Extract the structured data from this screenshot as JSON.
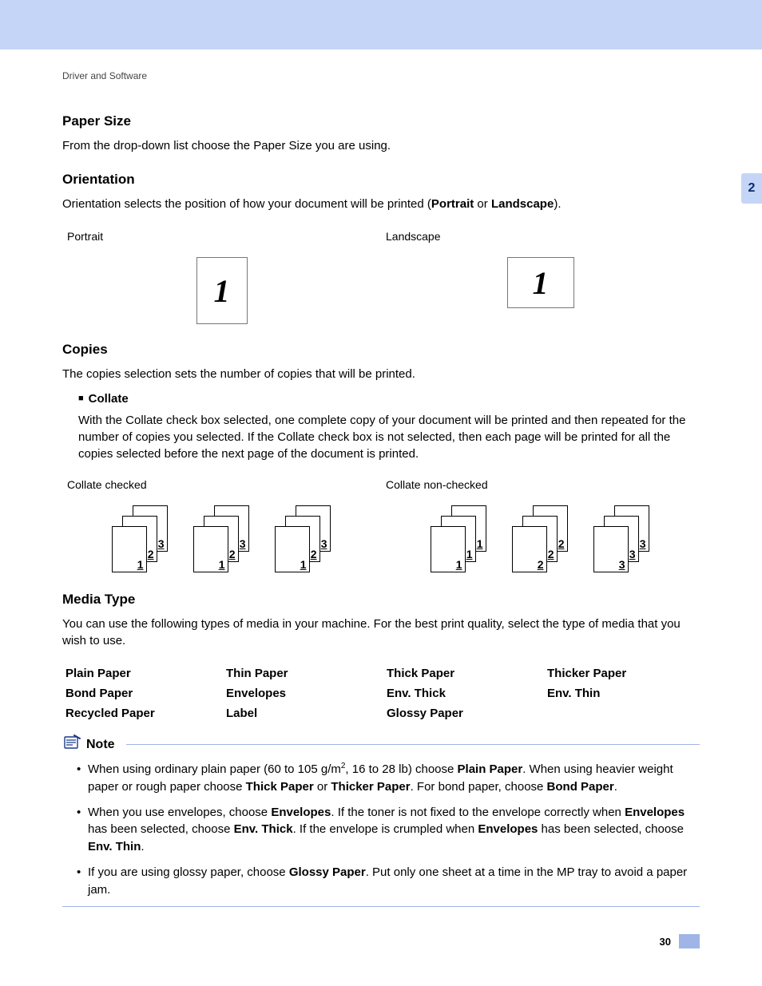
{
  "breadcrumb": "Driver and Software",
  "chapter_tab": "2",
  "paper_size": {
    "heading": "Paper Size",
    "text": "From the drop-down list choose the Paper Size you are using."
  },
  "orientation": {
    "heading": "Orientation",
    "pre": "Orientation selects the position of how your document will be printed (",
    "bold1": "Portrait",
    "mid": " or ",
    "bold2": "Landscape",
    "post": ").",
    "portrait_label": "Portrait",
    "landscape_label": "Landscape",
    "thumb_glyph": "1"
  },
  "copies": {
    "heading": "Copies",
    "text": "The copies selection sets the number of copies that will be printed.",
    "collate_heading": "Collate",
    "collate_text": "With the Collate check box selected, one complete copy of your document will be printed and then repeated for the number of copies you selected. If the Collate check box is not selected, then each page will be printed for all the copies selected before the next page of the document is printed.",
    "checked_label": "Collate checked",
    "nonchecked_label": "Collate non-checked",
    "checked_sets": [
      [
        "1",
        "2",
        "3"
      ],
      [
        "1",
        "2",
        "3"
      ],
      [
        "1",
        "2",
        "3"
      ]
    ],
    "nonchecked_sets": [
      [
        "1",
        "1",
        "1"
      ],
      [
        "2",
        "2",
        "2"
      ],
      [
        "3",
        "3",
        "3"
      ]
    ]
  },
  "media": {
    "heading": "Media Type",
    "text": "You can use the following types of media in your machine. For the best print quality, select the type of media that you wish to use.",
    "items": [
      "Plain Paper",
      "Thin Paper",
      "Thick Paper",
      "Thicker Paper",
      "Bond Paper",
      "Envelopes",
      "Env. Thick",
      "Env. Thin",
      "Recycled Paper",
      "Label",
      "Glossy Paper"
    ]
  },
  "note": {
    "heading": "Note",
    "n1": {
      "a": "When using ordinary plain paper (60 to 105 g/m",
      "sup": "2",
      "b": ", 16 to 28 lb) choose ",
      "c_bold": "Plain Paper",
      "d": ". When using heavier weight paper or rough paper choose ",
      "e_bold": "Thick Paper",
      "f": " or ",
      "g_bold": "Thicker Paper",
      "h": ". For bond paper, choose ",
      "i_bold": "Bond Paper",
      "j": "."
    },
    "n2": {
      "a": "When you use envelopes, choose ",
      "b_bold": "Envelopes",
      "c": ". If the toner is not fixed to the envelope correctly when ",
      "d_bold": "Envelopes",
      "e": " has been selected, choose ",
      "f_bold": "Env. Thick",
      "g": ". If the envelope is crumpled when ",
      "h_bold": "Envelopes",
      "i": " has been selected, choose ",
      "j_bold": "Env. Thin",
      "k": "."
    },
    "n3": {
      "a": "If you are using glossy paper, choose ",
      "b_bold": "Glossy Paper",
      "c": ". Put only one sheet at a time in the MP tray to avoid a paper jam."
    }
  },
  "page_number": "30"
}
